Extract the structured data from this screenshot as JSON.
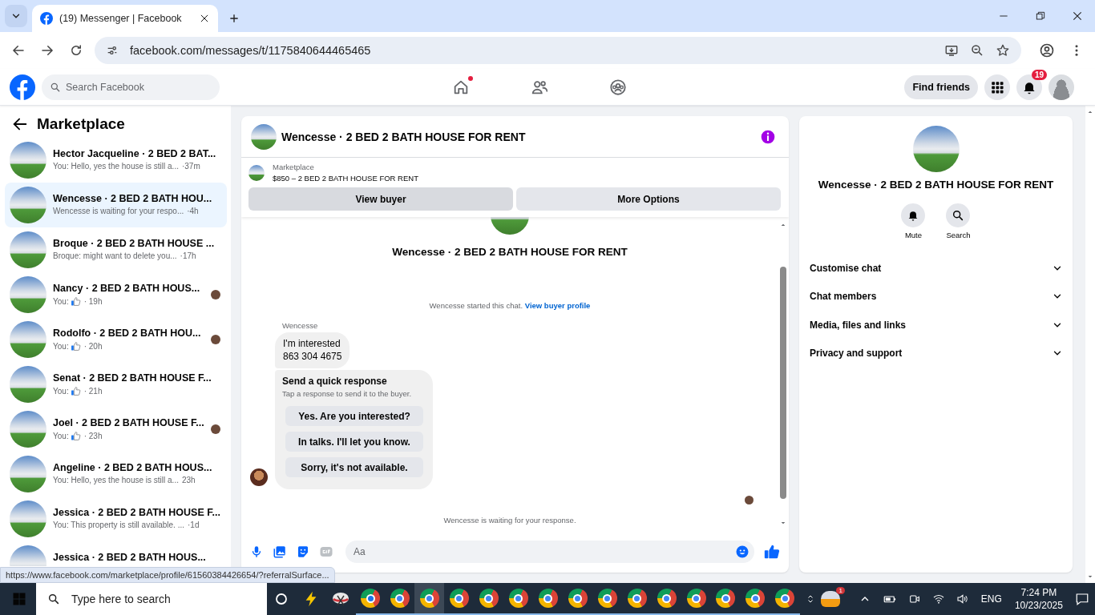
{
  "browser": {
    "tab_title": "(19) Messenger | Facebook",
    "url": "facebook.com/messages/t/1175840644465465"
  },
  "header": {
    "search_placeholder": "Search Facebook",
    "nav": [
      {
        "kind": "home",
        "dot": true
      },
      {
        "kind": "friends",
        "dot": false
      },
      {
        "kind": "groups",
        "dot": false
      }
    ],
    "find_friends": "Find friends",
    "notification_count": "19"
  },
  "sidebar": {
    "title": "Marketplace",
    "chats": [
      {
        "name": "Hector Jacqueline · 2 BED 2 BAT...",
        "preview": {
          "kind": "text",
          "text": "You: Hello, yes the house is still a...",
          "time": "·37m"
        },
        "seen_avatar": false,
        "selected": false
      },
      {
        "name": "Wencesse · 2 BED 2 BATH HOU...",
        "preview": {
          "kind": "text",
          "text": "Wencesse is waiting for your respo...",
          "time": "·4h"
        },
        "seen_avatar": false,
        "selected": true
      },
      {
        "name": "Broque · 2 BED 2 BATH HOUSE ...",
        "preview": {
          "kind": "text",
          "text": "Broque: might want to delete you...",
          "time": "·17h"
        },
        "seen_avatar": false,
        "selected": false
      },
      {
        "name": "Nancy · 2 BED 2 BATH HOUS...",
        "preview": {
          "kind": "like",
          "text": "You:",
          "time": "· 19h"
        },
        "seen_avatar": true,
        "selected": false
      },
      {
        "name": "Rodolfo · 2 BED 2 BATH HOU...",
        "preview": {
          "kind": "like",
          "text": "You:",
          "time": "· 20h"
        },
        "seen_avatar": true,
        "selected": false
      },
      {
        "name": "Senat · 2 BED 2 BATH HOUSE F...",
        "preview": {
          "kind": "like",
          "text": "You:",
          "time": "· 21h"
        },
        "seen_avatar": false,
        "selected": false
      },
      {
        "name": "Joel · 2 BED 2 BATH HOUSE F...",
        "preview": {
          "kind": "like",
          "text": "You:",
          "time": "· 23h"
        },
        "seen_avatar": true,
        "selected": false
      },
      {
        "name": "Angeline · 2 BED 2 BATH HOUS...",
        "preview": {
          "kind": "text",
          "text": "You: Hello, yes the house is still a...",
          "time": "23h"
        },
        "seen_avatar": false,
        "selected": false
      },
      {
        "name": "Jessica · 2 BED 2 BATH HOUSE F...",
        "preview": {
          "kind": "text",
          "text": "You: This property is still available. ...",
          "time": "·1d"
        },
        "seen_avatar": false,
        "selected": false
      },
      {
        "name": "Jessica · 2 BED 2 BATH HOUS...",
        "seen_avatar": false,
        "selected": false
      }
    ]
  },
  "chat": {
    "title": "Wencesse · 2 BED 2 BATH HOUSE FOR RENT",
    "banner": {
      "label": "Marketplace",
      "listing": "$850 – 2 BED 2 BATH HOUSE FOR RENT"
    },
    "buttons": [
      "View buyer",
      "More Options"
    ],
    "intro_name": "Wencesse · 2 BED 2 BATH HOUSE FOR RENT",
    "system": {
      "text": "Wencesse started this chat.",
      "link": "View buyer profile"
    },
    "sender": "Wencesse",
    "message": "I'm interested\n863 304 4675",
    "quick_response": {
      "title": "Send a quick response",
      "subtitle": "Tap a response to send it to the buyer.",
      "options": [
        "Yes. Are you interested?",
        "In talks. I'll let you know.",
        "Sorry, it's not available."
      ]
    },
    "waiting": "Wencesse is waiting for your response.",
    "composer_placeholder": "Aa"
  },
  "details": {
    "name": "Wencesse · 2 BED 2 BATH HOUSE FOR RENT",
    "actions": [
      {
        "kind": "bell",
        "label": "Mute"
      },
      {
        "kind": "search",
        "label": "Search"
      }
    ],
    "sections": [
      {
        "label": "Customise chat",
        "expanded": false
      },
      {
        "label": "Chat members",
        "expanded": false
      },
      {
        "label": "Media, files and links",
        "expanded": false
      },
      {
        "label": "Privacy and support",
        "expanded": false
      }
    ]
  },
  "status_url": "https://www.facebook.com/marketplace/profile/61560384426654/?referralSurface...",
  "taskbar": {
    "search_placeholder": "Type here to search",
    "apps": [
      {
        "kind": "circle",
        "selected": false
      },
      {
        "kind": "bolt",
        "selected": false
      },
      {
        "kind": "snip",
        "selected": false
      },
      {
        "kind": "chrome-m",
        "selected": false
      },
      {
        "kind": "chrome",
        "selected": false
      },
      {
        "kind": "chrome",
        "selected": true
      },
      {
        "kind": "chrome",
        "selected": false
      },
      {
        "kind": "chrome",
        "selected": false
      },
      {
        "kind": "chrome",
        "selected": false
      },
      {
        "kind": "chrome",
        "selected": false
      },
      {
        "kind": "chrome",
        "selected": false
      },
      {
        "kind": "chrome",
        "selected": false
      },
      {
        "kind": "chrome",
        "selected": false
      },
      {
        "kind": "chrome",
        "selected": false
      },
      {
        "kind": "chrome",
        "selected": false
      },
      {
        "kind": "chrome",
        "selected": false
      },
      {
        "kind": "chrome",
        "selected": false
      },
      {
        "kind": "chrome",
        "selected": false
      }
    ],
    "weather_badge": "1",
    "language": "ENG",
    "time": "7:24 PM",
    "date": "10/23/2025"
  }
}
